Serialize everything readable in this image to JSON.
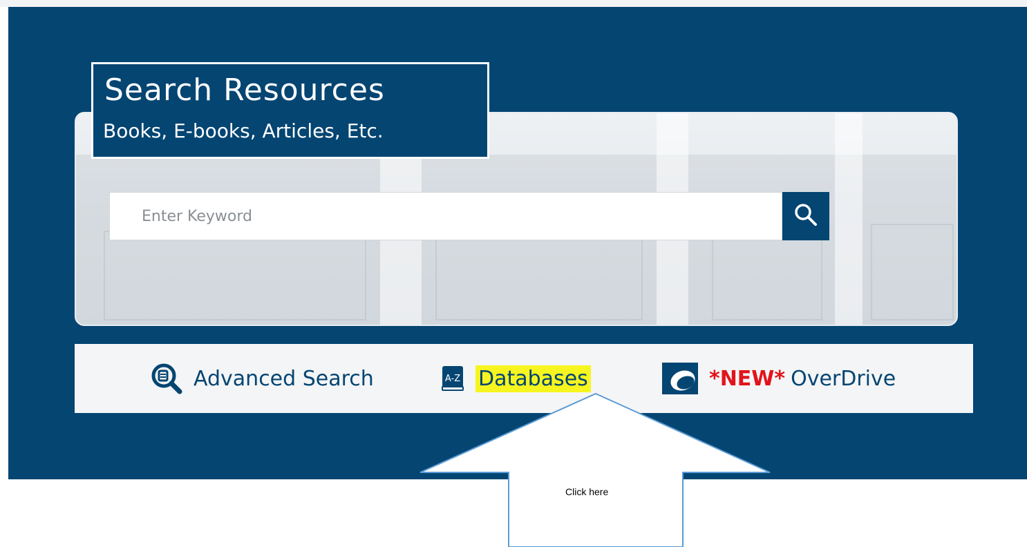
{
  "header": {
    "title": "Search Resources",
    "subtitle": "Books, E-books, Articles, Etc."
  },
  "search": {
    "placeholder": "Enter Keyword",
    "value": "",
    "button_icon": "search-icon"
  },
  "links": [
    {
      "label": "Advanced Search",
      "icon": "magnify-document-icon"
    },
    {
      "label": "Databases",
      "icon": "a-z-book-icon",
      "highlighted": true,
      "highlight_color": "#f7f51f"
    },
    {
      "new_tag": "*NEW*",
      "label": "OverDrive",
      "icon": "overdrive-logo-icon",
      "new_tag_color": "#e2141b"
    }
  ],
  "annotation": {
    "callout_text": "Click here"
  },
  "colors": {
    "brand_navy": "#044572",
    "link_bar_bg": "#f4f5f6",
    "arrow_stroke": "#5b9bd5"
  }
}
